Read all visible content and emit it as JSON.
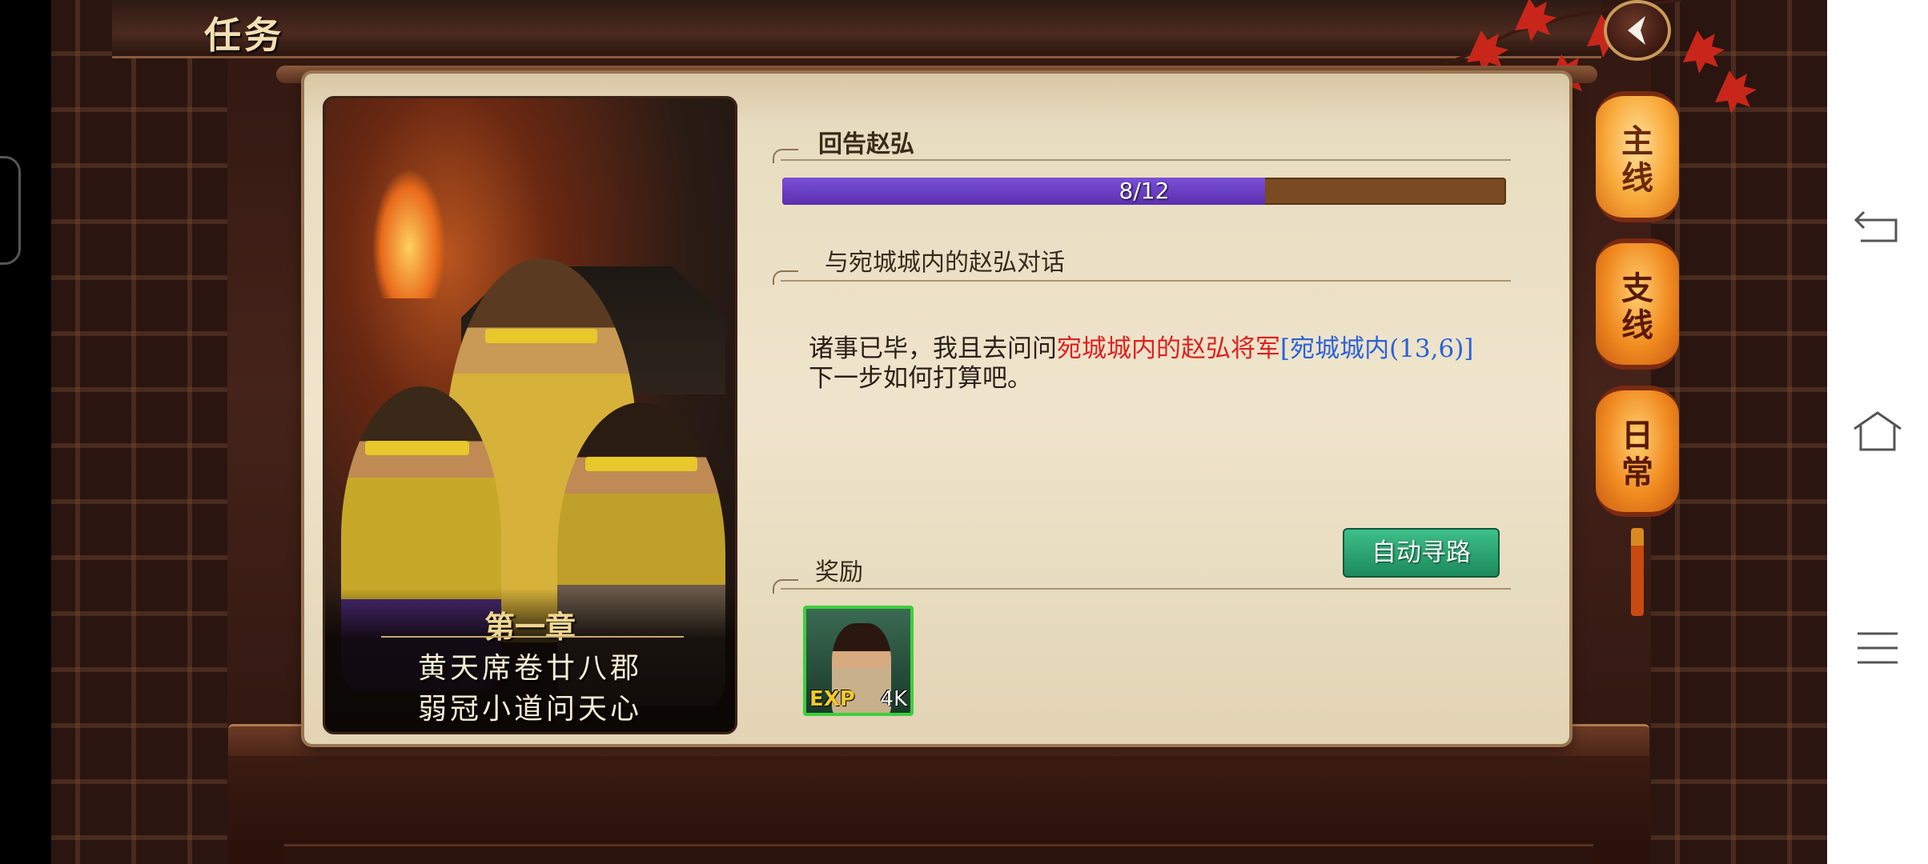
{
  "header": {
    "title": "任务"
  },
  "tabs": [
    {
      "label": "主线",
      "active": true
    },
    {
      "label": "支线",
      "active": false
    },
    {
      "label": "日常",
      "active": false
    }
  ],
  "chapter": {
    "label": "第一章",
    "title_line1": "黄天席卷廿八郡",
    "title_line2": "弱冠小道问天心"
  },
  "quest": {
    "name": "回告赵弘",
    "progress": {
      "text": "8/12",
      "current": 8,
      "total": 12
    },
    "objective": "与宛城城内的赵弘对话",
    "desc_part1": "诸事已毕，我且去问问",
    "desc_highlight": "宛城城内的赵弘将军",
    "desc_location": "[宛城城内(13,6)]",
    "desc_part2": "下一步如何打算吧。",
    "auto_path_label": "自动寻路"
  },
  "reward": {
    "heading": "奖励",
    "items": [
      {
        "type_label": "EXP",
        "amount": "4K"
      }
    ]
  },
  "colors": {
    "progress_fill": "#6a3fc8",
    "progress_track": "#7a4a22",
    "highlight_red": "#e02020",
    "highlight_blue": "#2a62d8",
    "auto_button": "#2aa874"
  },
  "system_nav": {
    "icons": [
      "back-icon",
      "home-icon",
      "menu-icon"
    ]
  }
}
